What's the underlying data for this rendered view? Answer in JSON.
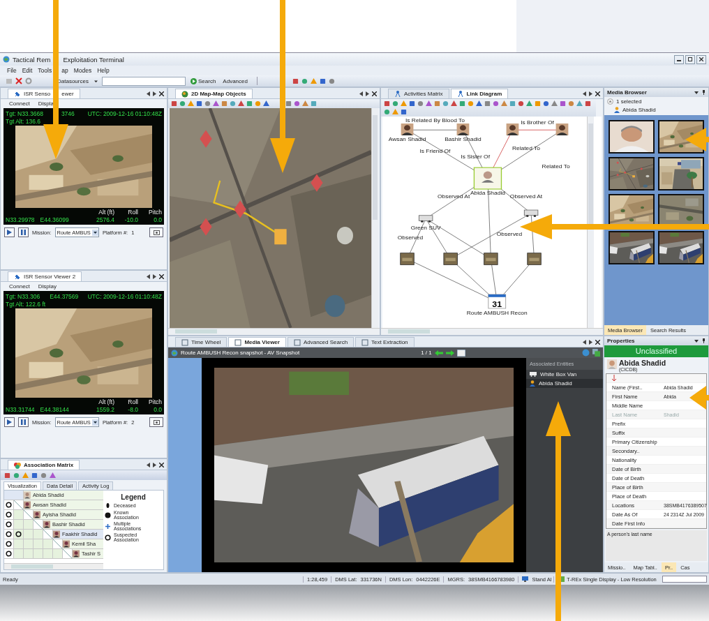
{
  "window": {
    "title_parts": [
      "Tactical Rem",
      "Exploitation Terminal"
    ]
  },
  "menu": [
    {
      "label": "File"
    },
    {
      "label": "Edit"
    },
    {
      "label": "Tools"
    },
    {
      "label": "ap"
    },
    {
      "label": "Modes"
    },
    {
      "label": "Help"
    }
  ],
  "toolbar": {
    "datasources": "Datasources",
    "search_button": "Search",
    "advanced_button": "Advanced"
  },
  "sensor_viewers": [
    {
      "tab_parts": [
        "ISR Senso",
        "ewer"
      ],
      "menu": [
        "Connect",
        "Displa"
      ],
      "target": [
        "Tgt: N33.3668",
        "3746"
      ],
      "utc": "UTC: 2009-12-16 01:10:48Z",
      "target_alt": "Tgt Alt: 136.6",
      "columns": [
        "Alt (ft)",
        "Roll",
        "Pitch"
      ],
      "position": [
        "N33.29978",
        "E44.36099"
      ],
      "readings": [
        "2576.4",
        "-10.0",
        "0.0"
      ],
      "mission_label": "Mission:",
      "mission": "Route AMBUS",
      "platform_label": "Platform #:",
      "platform": "1"
    },
    {
      "tab_parts": [
        "ISR Sensor Viewer 2"
      ],
      "menu": [
        "Connect",
        "Display"
      ],
      "target": [
        "Tgt: N33.306",
        "E44.37569"
      ],
      "utc": "UTC: 2009-12-16 01:10:48Z",
      "target_alt": "Tgt Alt: 122.6 ft",
      "columns": [
        "Alt (ft)",
        "Roll",
        "Pitch"
      ],
      "position": [
        "N33.31744",
        "E44.38144"
      ],
      "readings": [
        "1559.2",
        "-8.0",
        "0.0"
      ],
      "mission_label": "Mission:",
      "mission": "Route AMBUS",
      "platform_label": "Platform #:",
      "platform": "2"
    }
  ],
  "association_matrix": {
    "title": "Association Matrix",
    "tabs": [
      {
        "label": "Visualization",
        "selected": true
      },
      {
        "label": "Data Detail",
        "selected": false
      },
      {
        "label": "Activity Log",
        "selected": false
      }
    ],
    "head": "Abida Shadid",
    "rows": [
      {
        "name": "Awsan Shadid",
        "associations": [
          {
            "kind": "suspected"
          }
        ]
      },
      {
        "name": "Ayisha Shadid",
        "associations": [
          {
            "kind": "suspected"
          }
        ]
      },
      {
        "name": "Bashir Shadid",
        "associations": [
          {
            "kind": "suspected"
          }
        ]
      },
      {
        "name": "Faakhir Shadid",
        "associations": [
          {
            "kind": "suspected"
          },
          {
            "kind": "suspected"
          }
        ]
      },
      {
        "name": "Kemil Sha",
        "associations": [
          {
            "kind": "suspected"
          }
        ]
      },
      {
        "name": "Tashir S",
        "associations": [
          {
            "kind": "suspected"
          }
        ]
      }
    ],
    "legend_title": "Legend",
    "legend": [
      {
        "kind": "deceased",
        "label": "Deceased"
      },
      {
        "kind": "known",
        "label": "Known Association"
      },
      {
        "kind": "multiple",
        "label": "Multiple Associations"
      },
      {
        "kind": "suspected",
        "label": "Suspected Association"
      }
    ]
  },
  "map_panel": {
    "tab": "2D Map-Map Objects"
  },
  "link_panel": {
    "tabs": [
      {
        "label": "Activities Matrix",
        "selected": false
      },
      {
        "label": "Link Diagram",
        "selected": true
      }
    ],
    "nodes": [
      {
        "kind": "person",
        "label": "Awsan Shadid"
      },
      {
        "kind": "person",
        "label": "Bashir Shadid"
      },
      {
        "kind": "person"
      },
      {
        "kind": "person"
      },
      {
        "kind": "focus",
        "label": "Abida Shadid"
      },
      {
        "kind": "vehicle",
        "label": "Green SUV"
      },
      {
        "kind": "vehicle"
      },
      {
        "kind": "snapshot"
      },
      {
        "kind": "snapshot"
      },
      {
        "kind": "snapshot"
      },
      {
        "kind": "snapshot"
      },
      {
        "kind": "event",
        "day": "31",
        "label": "Route AMBUSH Recon"
      }
    ],
    "edge_labels": [
      "Is Related By Blood To",
      "Is Brother Of",
      "Is Friend Of",
      "Is Sister Of",
      "Related To",
      "Related To",
      "Observed At",
      "Observed At",
      "Observed",
      "Observed"
    ]
  },
  "viewer": {
    "tabs": [
      {
        "label": "Time Wheel",
        "selected": false
      },
      {
        "label": "Media Viewer",
        "selected": true
      },
      {
        "label": "Advanced Search",
        "selected": false
      },
      {
        "label": "Text Extraction",
        "selected": false
      }
    ],
    "title": "Route AMBUSH Recon snapshot - AV Snapshot",
    "counter": "1 / 1",
    "entities_title": "Associated Entities",
    "entities": [
      {
        "kind": "vehicle",
        "label": "White Box Van",
        "selected": false
      },
      {
        "kind": "person",
        "label": "Abida Shadid",
        "selected": true
      }
    ]
  },
  "media_browser": {
    "title": "Media Browser",
    "selection": "1 selected",
    "entity": "Abida Shadid",
    "tabs": [
      {
        "label": "Media Browser",
        "selected": true
      },
      {
        "label": "Search Results",
        "selected": false
      }
    ]
  },
  "properties": {
    "title": "Properties",
    "classification": "Unclassified",
    "name": "Abida Shadid",
    "source": "(CICDB)",
    "rows": [
      {
        "name": "Name (First..",
        "value": "Abida Shadid",
        "disabled": false
      },
      {
        "name": "First Name",
        "value": "Abida",
        "disabled": false
      },
      {
        "name": "Middle Name",
        "disabled": false
      },
      {
        "name": "Last Name",
        "value": "Shadid",
        "disabled": true
      },
      {
        "name": "Prefix",
        "disabled": false
      },
      {
        "name": "Suffix",
        "disabled": false
      },
      {
        "name": "Primary Citizenship",
        "disabled": false
      },
      {
        "name": "Secondary..",
        "disabled": false
      },
      {
        "name": "Nationality",
        "disabled": false
      },
      {
        "name": "Date of Birth",
        "disabled": false
      },
      {
        "name": "Date of Death",
        "disabled": false
      },
      {
        "name": "Place of Birth",
        "disabled": false
      },
      {
        "name": "Place of Death",
        "disabled": false
      },
      {
        "name": "Locations",
        "value": "38SMB4176389507",
        "disabled": false
      },
      {
        "name": "Date As Of",
        "value": "24 2314Z Jul 2009",
        "disabled": false
      },
      {
        "name": "Date First Info",
        "disabled": false
      }
    ],
    "description": "A person's last name",
    "tabs": [
      {
        "label": "Missio..",
        "selected": false
      },
      {
        "label": "Map Tabl..",
        "selected": false
      },
      {
        "label": "Pr..",
        "selected": true
      },
      {
        "label": "Cas",
        "selected": false
      }
    ]
  },
  "status_bar": {
    "ready": "Ready",
    "scale": "1:28,459",
    "fields": [
      {
        "label": "DMS Lat:",
        "value": "331736N"
      },
      {
        "label": "DMS Lon:",
        "value": "0442226E"
      },
      {
        "label": "MGRS:",
        "value": "38SMB4166783980"
      }
    ],
    "mode": "Stand Al",
    "display": "T-REx Single Display - Low Resolution",
    "progress": {
      "level": 0
    }
  },
  "callout_arrows": [
    {
      "kind": "down"
    },
    {
      "kind": "down"
    },
    {
      "kind": "left"
    },
    {
      "kind": "left"
    },
    {
      "kind": "left"
    },
    {
      "kind": "up"
    }
  ]
}
